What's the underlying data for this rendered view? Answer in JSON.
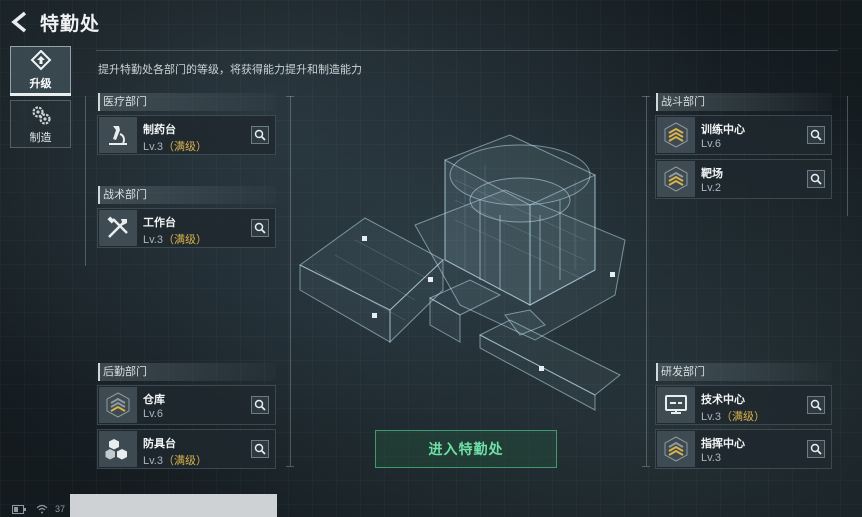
{
  "header": {
    "title": "特勤处",
    "subtitle": "提升特勤处各部门的等级，将获得能力提升和制造能力"
  },
  "tabs": [
    {
      "label": "升级",
      "icon": "upgrade-icon",
      "active": true
    },
    {
      "label": "制造",
      "icon": "gear-icon",
      "active": false
    }
  ],
  "sections": {
    "medical": {
      "title": "医疗部门",
      "items": [
        {
          "name": "制药台",
          "level": "Lv.3",
          "max": "（满级）",
          "icon": "microscope-icon"
        }
      ]
    },
    "tactical": {
      "title": "战术部门",
      "items": [
        {
          "name": "工作台",
          "level": "Lv.3",
          "max": "（满级）",
          "icon": "tools-icon"
        }
      ]
    },
    "logistics": {
      "title": "后勤部门",
      "items": [
        {
          "name": "仓库",
          "level": "Lv.6",
          "max": "",
          "icon": "rank-chevron-icon"
        },
        {
          "name": "防具台",
          "level": "Lv.3",
          "max": "（满级）",
          "icon": "cubes-icon"
        }
      ]
    },
    "combat": {
      "title": "战斗部门",
      "items": [
        {
          "name": "训练中心",
          "level": "Lv.6",
          "max": "",
          "icon": "rank-chevron-icon"
        },
        {
          "name": "靶场",
          "level": "Lv.2",
          "max": "",
          "icon": "rank-chevron-icon"
        }
      ]
    },
    "research": {
      "title": "研发部门",
      "items": [
        {
          "name": "技术中心",
          "level": "Lv.3",
          "max": "（满级）",
          "icon": "monitor-icon"
        },
        {
          "name": "指挥中心",
          "level": "Lv.3",
          "max": "",
          "icon": "rank-chevron-icon"
        }
      ]
    }
  },
  "enter_button": "进入特勤处",
  "status": {
    "battery_text": "37"
  },
  "colors": {
    "accent_green": "#6fe0a7",
    "max_gold": "#d9b24c",
    "background": "#1b2328"
  }
}
